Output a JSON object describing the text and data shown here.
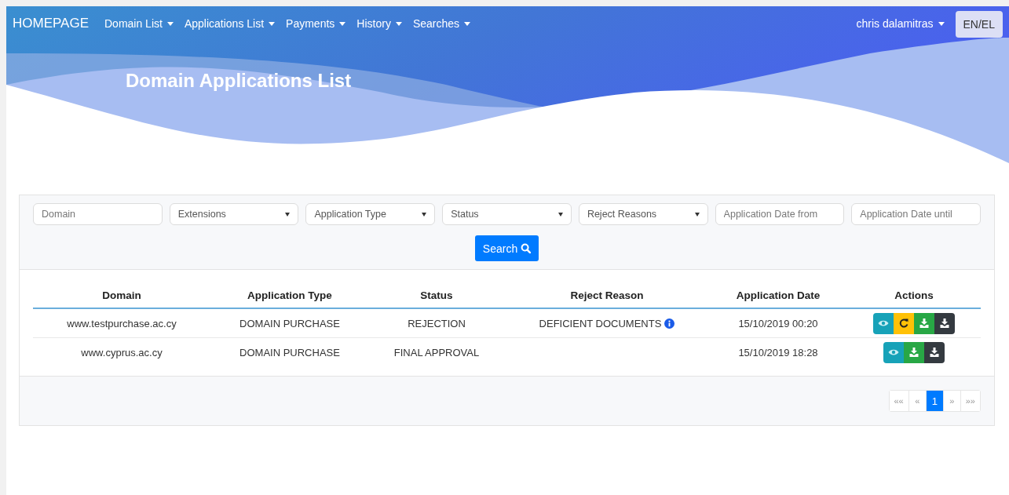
{
  "navbar": {
    "brand": "HOMEPAGE",
    "menus": [
      {
        "label": "Domain List"
      },
      {
        "label": "Applications List"
      },
      {
        "label": "Payments"
      },
      {
        "label": "History"
      },
      {
        "label": "Searches"
      }
    ],
    "user": "chris dalamitras",
    "language_button": "EN/EL"
  },
  "page_title": "Domain Applications List",
  "filters": [
    {
      "kind": "input",
      "placeholder": "Domain"
    },
    {
      "kind": "select",
      "label": "Extensions"
    },
    {
      "kind": "select",
      "label": "Application Type"
    },
    {
      "kind": "select",
      "label": "Status"
    },
    {
      "kind": "select",
      "label": "Reject Reasons"
    },
    {
      "kind": "input",
      "placeholder": "Application Date from"
    },
    {
      "kind": "input",
      "placeholder": "Application Date until"
    }
  ],
  "search_button": "Search",
  "table": {
    "columns": [
      "Domain",
      "Application Type",
      "Status",
      "Reject Reason",
      "Application Date",
      "Actions"
    ],
    "rows": [
      {
        "domain": "www.testpurchase.ac.cy",
        "application_type": "DOMAIN PURCHASE",
        "status": "REJECTION",
        "reject_reason": "DEFICIENT DOCUMENTS",
        "info": true,
        "application_date": "15/10/2019 00:20",
        "actions": [
          {
            "kind": "view"
          },
          {
            "kind": "reload"
          },
          {
            "kind": "download"
          },
          {
            "kind": "download-dark"
          }
        ]
      },
      {
        "domain": "www.cyprus.ac.cy",
        "application_type": "DOMAIN PURCHASE",
        "status": "FINAL APPROVAL",
        "application_date": "15/10/2019 18:28",
        "actions": [
          {
            "kind": "view"
          },
          {
            "kind": "download"
          },
          {
            "kind": "download-dark"
          }
        ]
      }
    ]
  },
  "pagination": [
    {
      "label": "««",
      "selected": false
    },
    {
      "label": "«",
      "selected": false
    },
    {
      "label": "1",
      "selected": true
    },
    {
      "label": "»",
      "selected": false
    },
    {
      "label": "»»",
      "selected": false
    }
  ]
}
